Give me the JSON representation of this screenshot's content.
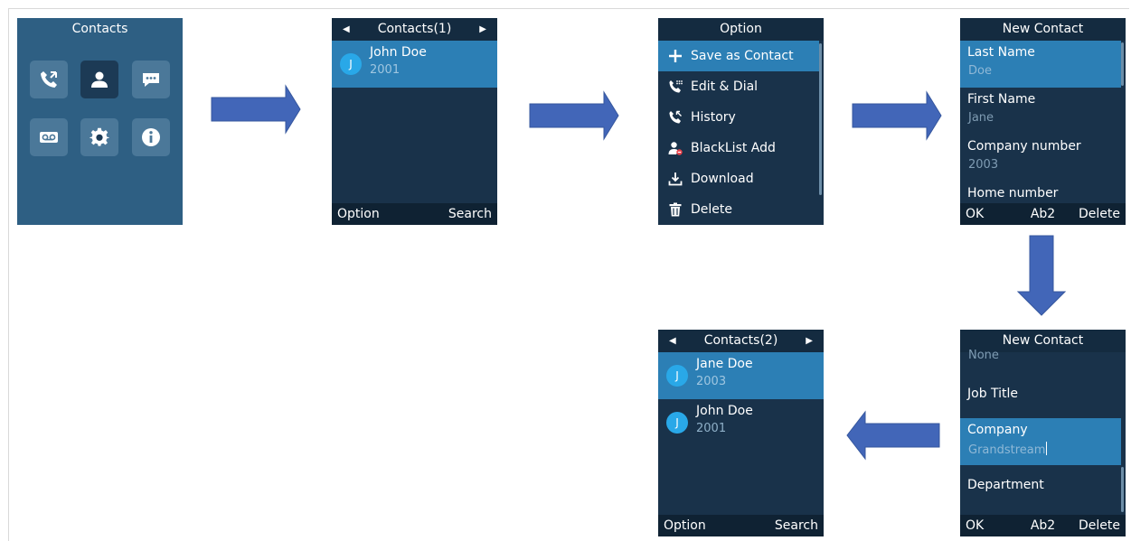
{
  "home": {
    "title": "Contacts",
    "icons": [
      "call-history-icon",
      "contacts-icon",
      "messages-icon",
      "voicemail-icon",
      "settings-icon",
      "info-icon"
    ]
  },
  "contacts1": {
    "title": "Contacts(1)",
    "rows": [
      {
        "initial": "J",
        "name": "John Doe",
        "number": "2001"
      }
    ],
    "softkeys": {
      "left": "Option",
      "right": "Search"
    }
  },
  "option": {
    "title": "Option",
    "items": [
      {
        "icon": "plus-icon",
        "label": "Save as Contact"
      },
      {
        "icon": "dial-icon",
        "label": "Edit & Dial"
      },
      {
        "icon": "history-icon",
        "label": "History"
      },
      {
        "icon": "blacklist-icon",
        "label": "BlackList Add"
      },
      {
        "icon": "download-icon",
        "label": "Download"
      },
      {
        "icon": "trash-icon",
        "label": "Delete"
      }
    ]
  },
  "new_contact_1": {
    "title": "New Contact",
    "fields": [
      {
        "label": "Last Name",
        "value": "Doe"
      },
      {
        "label": "First Name",
        "value": "Jane"
      },
      {
        "label": "Company number",
        "value": "2003"
      },
      {
        "label": "Home number",
        "value": ""
      }
    ],
    "softkeys": {
      "left": "OK",
      "mid": "Ab2",
      "right": "Delete"
    }
  },
  "new_contact_2": {
    "title": "New Contact",
    "top_value": "None",
    "fields": [
      {
        "label": "Job Title",
        "value": ""
      },
      {
        "label": "Company",
        "value": "Grandstream"
      },
      {
        "label": "Department",
        "value": ""
      }
    ],
    "softkeys": {
      "left": "OK",
      "mid": "Ab2",
      "right": "Delete"
    }
  },
  "contacts2": {
    "title": "Contacts(2)",
    "rows": [
      {
        "initial": "J",
        "name": "Jane Doe",
        "number": "2003"
      },
      {
        "initial": "J",
        "name": "John Doe",
        "number": "2001"
      }
    ],
    "softkeys": {
      "left": "Option",
      "right": "Search"
    }
  },
  "colors": {
    "arrow": "#4266b8",
    "screen_bg": "#19324a",
    "highlight": "#2c7fb5",
    "home_bg": "#2e5f83"
  }
}
